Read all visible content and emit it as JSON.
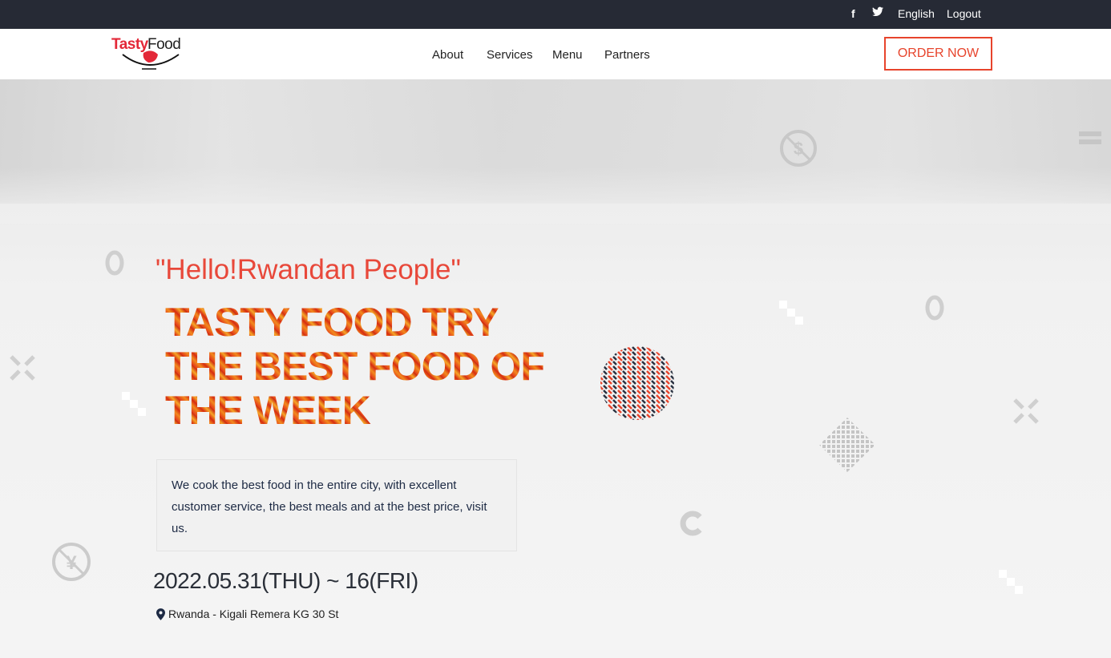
{
  "topbar": {
    "facebook_icon": "facebook-icon",
    "twitter_icon": "twitter-icon",
    "language": "English",
    "logout": "Logout"
  },
  "header": {
    "logo_part1": "Tasty",
    "logo_part2": "Food",
    "nav": [
      "About",
      "Services",
      "Menu",
      "Partners"
    ],
    "order_button": "ORDER NOW"
  },
  "hero": {
    "greeting": "\"Hello!Rwandan People\"",
    "headline_lines": [
      "TASTY FOOD TRY",
      "THE BEST FOOD OF",
      "THE WEEK"
    ],
    "description": "We cook the best food in the entire city, with excellent customer service, the best meals and at the best price, visit us.",
    "date": "2022.05.31(THU) ~ 16(FRI)",
    "location": "Rwanda - Kigali Remera KG 30 St"
  },
  "colors": {
    "accent": "#e7442c",
    "topbar_bg": "#262a35",
    "text_dark": "#1d2a44"
  }
}
